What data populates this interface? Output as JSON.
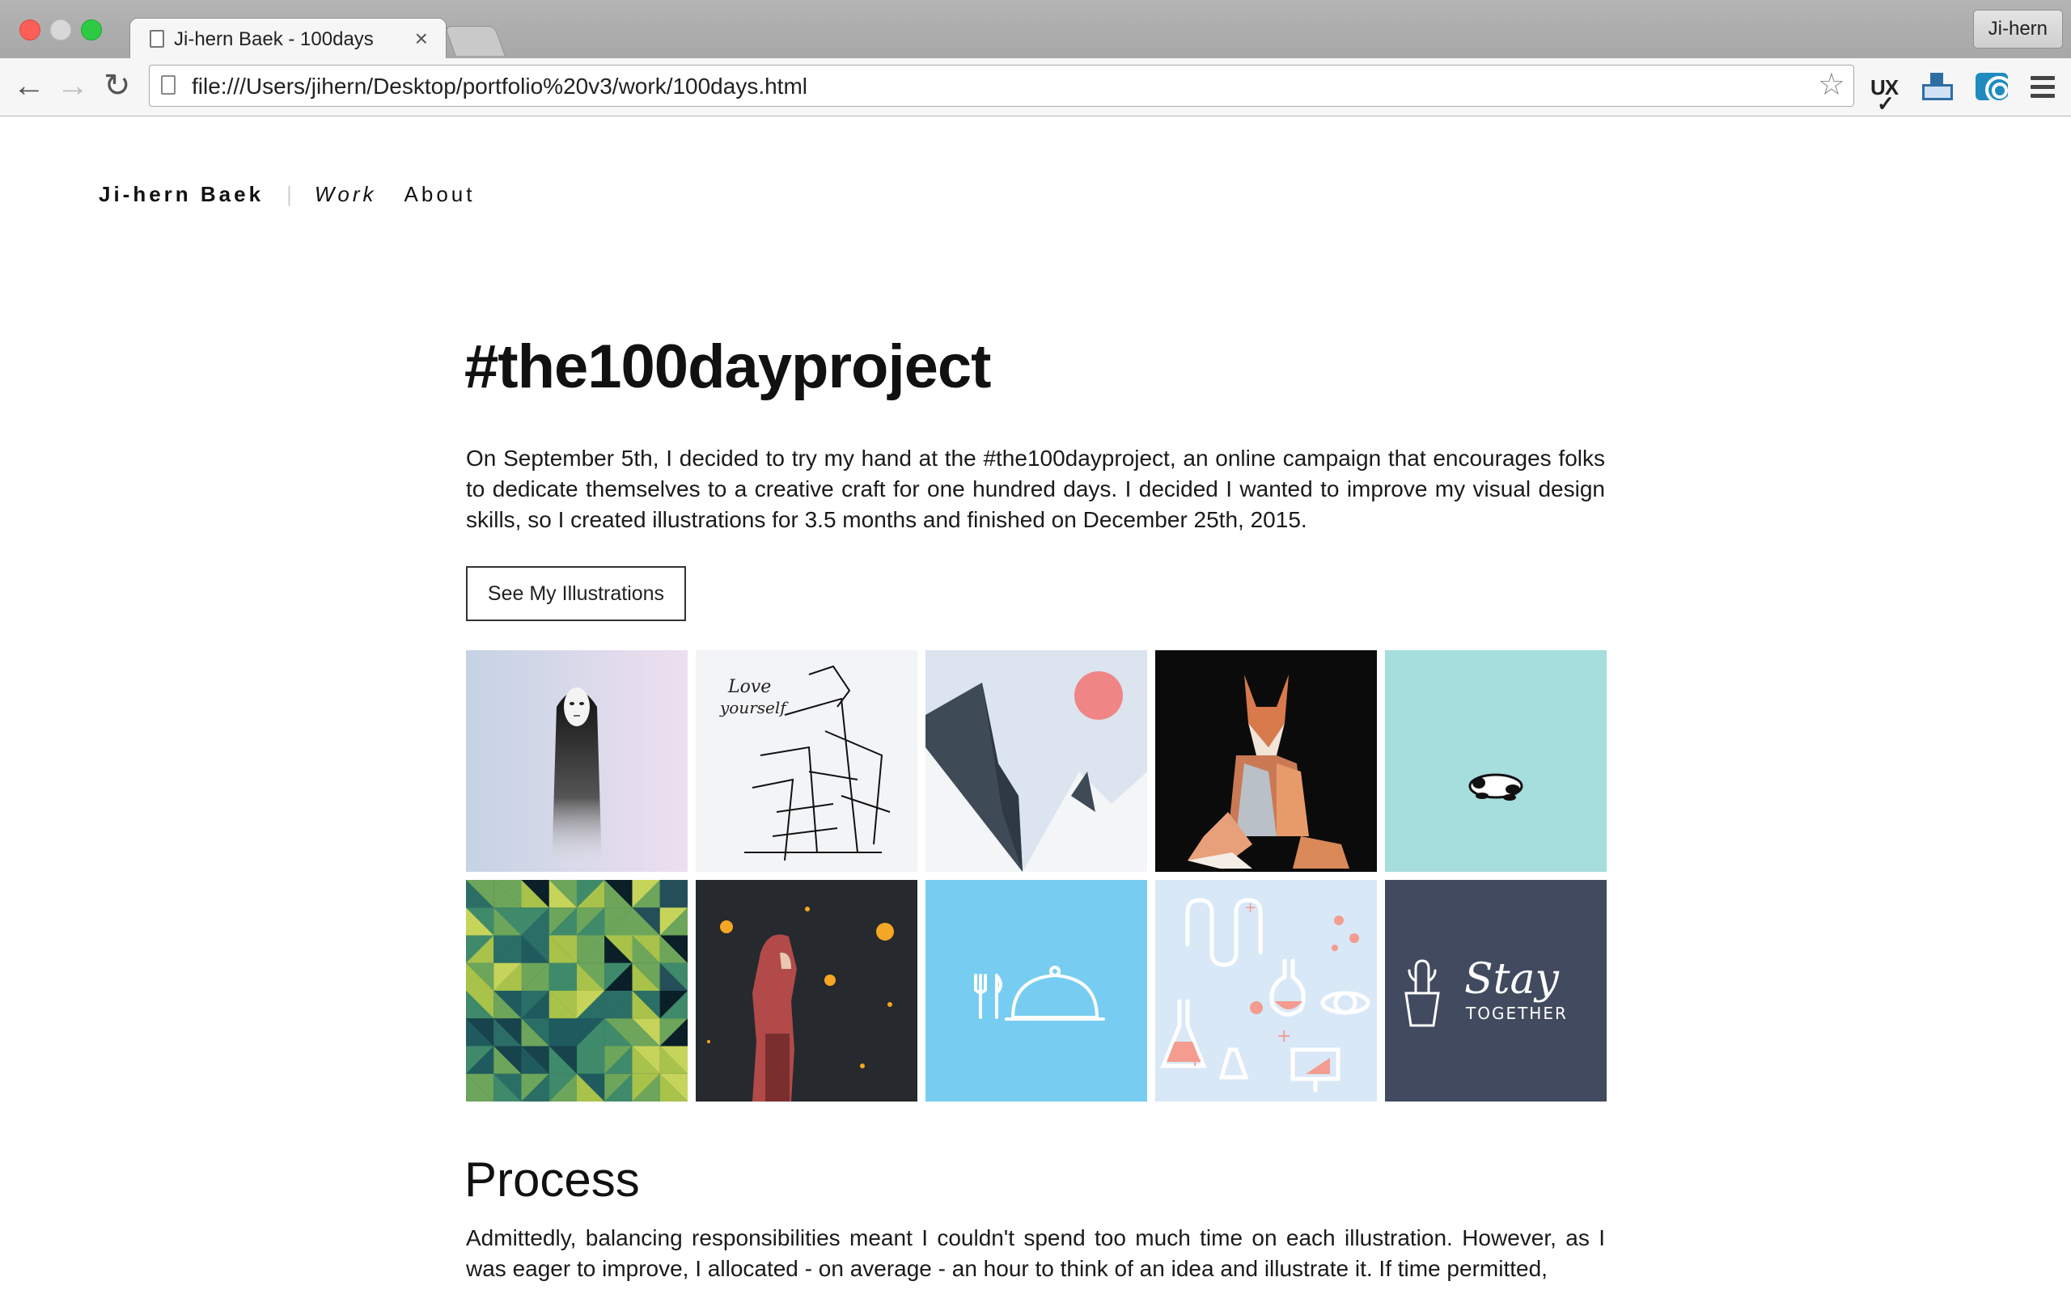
{
  "browser": {
    "tab_title": "Ji-hern Baek - 100days",
    "tab_close": "×",
    "profile_name": "Ji-hern",
    "url": "file:///Users/jihern/Desktop/portfolio%20v3/work/100days.html",
    "icons": [
      "back-arrow-icon",
      "forward-arrow-icon",
      "reload-icon",
      "page-icon",
      "bookmark-star-icon",
      "ux-check-extension-icon",
      "tray-extension-icon",
      "wave-extension-icon",
      "hamburger-menu-icon"
    ],
    "extension_ux_label": "UX"
  },
  "site_nav": {
    "brand": "Ji-hern Baek",
    "separator": "|",
    "work": "Work",
    "about": "About"
  },
  "page": {
    "title": "#the100dayproject",
    "intro": "On September 5th, I decided to try my hand at the #the100dayproject, an online campaign that encourages folks to dedicate themselves to a creative craft for one hundred days. I decided I wanted to improve my visual design skills, so I created illustrations for 3.5 months and finished on December 25th, 2015.",
    "cta_label": "See My Illustrations",
    "gallery": [
      {
        "name": "no-face",
        "bg": "#c9d5e4"
      },
      {
        "name": "love-yourself-sketch",
        "bg": "#f3f4f6",
        "caption_line1": "Love",
        "caption_line2": "yourself"
      },
      {
        "name": "mountain-sun",
        "bg": "#dbe4ef",
        "accent": "#f08585"
      },
      {
        "name": "low-poly-fox",
        "bg": "#0b0b0b",
        "accent": "#d9825b"
      },
      {
        "name": "sleeping-panda",
        "bg": "#a6dddd"
      },
      {
        "name": "triangle-pattern",
        "bg": "#1f4d55",
        "accent": "#a8c24a"
      },
      {
        "name": "red-riding-hood",
        "bg": "#26292d",
        "accent": "#b24a4a"
      },
      {
        "name": "food-cloche",
        "bg": "#77cdf1"
      },
      {
        "name": "science-lab",
        "bg": "#d8e8f7",
        "accent": "#f39c8f"
      },
      {
        "name": "stay-together",
        "bg": "#414a5e",
        "caption_line1": "Stay",
        "caption_line2": "TOGETHER"
      }
    ],
    "process_heading": "Process",
    "process_text": "Admittedly, balancing responsibilities meant I couldn't spend too much time on each illustration. However, as I was eager to improve, I allocated - on average - an hour to think of an idea and illustrate it. If time permitted,"
  }
}
